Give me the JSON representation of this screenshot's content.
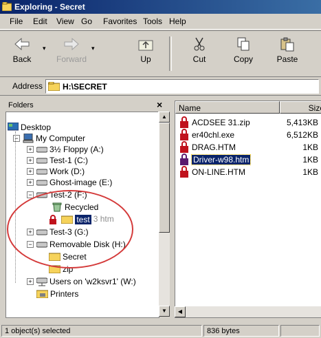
{
  "window": {
    "title": "Exploring - Secret"
  },
  "menu": [
    "File",
    "Edit",
    "View",
    "Go",
    "Favorites",
    "Tools",
    "Help"
  ],
  "toolbar": {
    "back": "Back",
    "forward": "Forward",
    "up": "Up",
    "cut": "Cut",
    "copy": "Copy",
    "paste": "Paste"
  },
  "address": {
    "label": "Address",
    "value": "H:\\SECRET"
  },
  "folders": {
    "title": "Folders",
    "close": "×",
    "tree": [
      {
        "label": "Desktop"
      },
      {
        "label": "My Computer"
      },
      {
        "label": "3½ Floppy (A:)"
      },
      {
        "label": "Test-1 (C:)"
      },
      {
        "label": "Work (D:)"
      },
      {
        "label": "Ghost-image (E:)"
      },
      {
        "label": "Test-2 (F:)"
      },
      {
        "label": "Recycled"
      },
      {
        "label": "test"
      },
      {
        "label": "3 htm"
      },
      {
        "label": "Test-3 (G:)"
      },
      {
        "label": "Removable Disk (H:)"
      },
      {
        "label": "Secret"
      },
      {
        "label": "zip"
      },
      {
        "label": "Users on 'w2ksvr1' (W:)"
      },
      {
        "label": "Printers"
      }
    ]
  },
  "files": {
    "columns": {
      "name": "Name",
      "size": "Size"
    },
    "rows": [
      {
        "name": "ACDSEE 31.zip",
        "size": "5,413KB"
      },
      {
        "name": "er40chl.exe",
        "size": "6,512KB"
      },
      {
        "name": "DRAG.HTM",
        "size": "1KB"
      },
      {
        "name": "Driver-w98.htm",
        "size": "1KB",
        "selected": true
      },
      {
        "name": "ON-LINE.HTM",
        "size": "1KB"
      }
    ]
  },
  "status": {
    "objects": "1 object(s) selected",
    "bytes": "836 bytes"
  },
  "colors": {
    "titlebar": "#0a246a",
    "selection": "#0a246a",
    "annotation": "#d43a3a",
    "lock": "#c0121d"
  }
}
